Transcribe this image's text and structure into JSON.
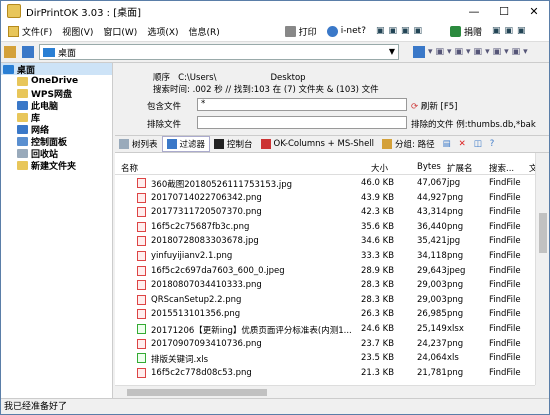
{
  "window": {
    "title": "DirPrintOK 3.03 : [桌面]"
  },
  "menu": {
    "items": [
      "文件(F)",
      "视图(V)",
      "窗口(W)",
      "选项(X)",
      "信息(R)"
    ],
    "print": "打印",
    "inet": "i-net?",
    "donate": "捐赠"
  },
  "toolbar": {
    "location": "桌面"
  },
  "tree": {
    "items": [
      "桌面",
      "OneDrive",
      "WPS网盘",
      "此电脑",
      "库",
      "网络",
      "控制面板",
      "回收站",
      "新建文件夹"
    ]
  },
  "info": {
    "order_label": "顺序",
    "path": "C:\\Users\\",
    "path_tail": "Desktop",
    "stats": "搜索时间: .002 秒 //  找到:103 在 (7) 文件夹 & (103) 文件",
    "include_label": "包含文件",
    "include_value": "*",
    "refresh": "刷新 [F5]",
    "exclude_label": "排除文件",
    "exclude_hint": "排除的文件 例:thumbs.db,*bak"
  },
  "tabs": [
    "树列表",
    "过滤器",
    "控制台",
    "OK-Columns + MS-Shell",
    "分组: 路径"
  ],
  "grid": {
    "columns": [
      "名称",
      "大小",
      "Bytes",
      "扩展名",
      "搜索...",
      "文"
    ],
    "rows": [
      {
        "name": "360截图20180526111753153.jpg",
        "size": "46.0 KB",
        "bytes": "47,067",
        "ext": "jpg",
        "search": "FindFile",
        "icon": "img"
      },
      {
        "name": "20170714022706342.png",
        "size": "43.9 KB",
        "bytes": "44,927",
        "ext": "png",
        "search": "FindFile",
        "icon": "img"
      },
      {
        "name": "20177311720507370.png",
        "size": "42.3 KB",
        "bytes": "43,314",
        "ext": "png",
        "search": "FindFile",
        "icon": "img"
      },
      {
        "name": "16f5c2c75687fb3c.png",
        "size": "35.6 KB",
        "bytes": "36,440",
        "ext": "png",
        "search": "FindFile",
        "icon": "img"
      },
      {
        "name": "20180728083303678.jpg",
        "size": "34.6 KB",
        "bytes": "35,421",
        "ext": "jpg",
        "search": "FindFile",
        "icon": "img"
      },
      {
        "name": "yinfuyijianv2.1.png",
        "size": "33.3 KB",
        "bytes": "34,118",
        "ext": "png",
        "search": "FindFile",
        "icon": "img"
      },
      {
        "name": "16f5c2c697da7603_600_0.jpeg",
        "size": "28.9 KB",
        "bytes": "29,643",
        "ext": "jpeg",
        "search": "FindFile",
        "icon": "img"
      },
      {
        "name": "20180807034410333.png",
        "size": "28.3 KB",
        "bytes": "29,003",
        "ext": "png",
        "search": "FindFile",
        "icon": "img"
      },
      {
        "name": "QRScanSetup2.2.png",
        "size": "28.3 KB",
        "bytes": "29,003",
        "ext": "png",
        "search": "FindFile",
        "icon": "img"
      },
      {
        "name": "2015513101356.png",
        "size": "26.3 KB",
        "bytes": "26,985",
        "ext": "png",
        "search": "FindFile",
        "icon": "img"
      },
      {
        "name": "20171206【更新ing】优质页面评分标准表(内测1...",
        "size": "24.6 KB",
        "bytes": "25,149",
        "ext": "xlsx",
        "search": "FindFile",
        "icon": "xls"
      },
      {
        "name": "20170907093410736.png",
        "size": "23.7 KB",
        "bytes": "24,237",
        "ext": "png",
        "search": "FindFile",
        "icon": "img"
      },
      {
        "name": "排版关键词.xls",
        "size": "23.5 KB",
        "bytes": "24,064",
        "ext": "xls",
        "search": "FindFile",
        "icon": "xls"
      },
      {
        "name": "16f5c2c778d08c53.png",
        "size": "21.3 KB",
        "bytes": "21,781",
        "ext": "png",
        "search": "FindFile",
        "icon": "img"
      }
    ]
  },
  "status": "我已经准备好了"
}
